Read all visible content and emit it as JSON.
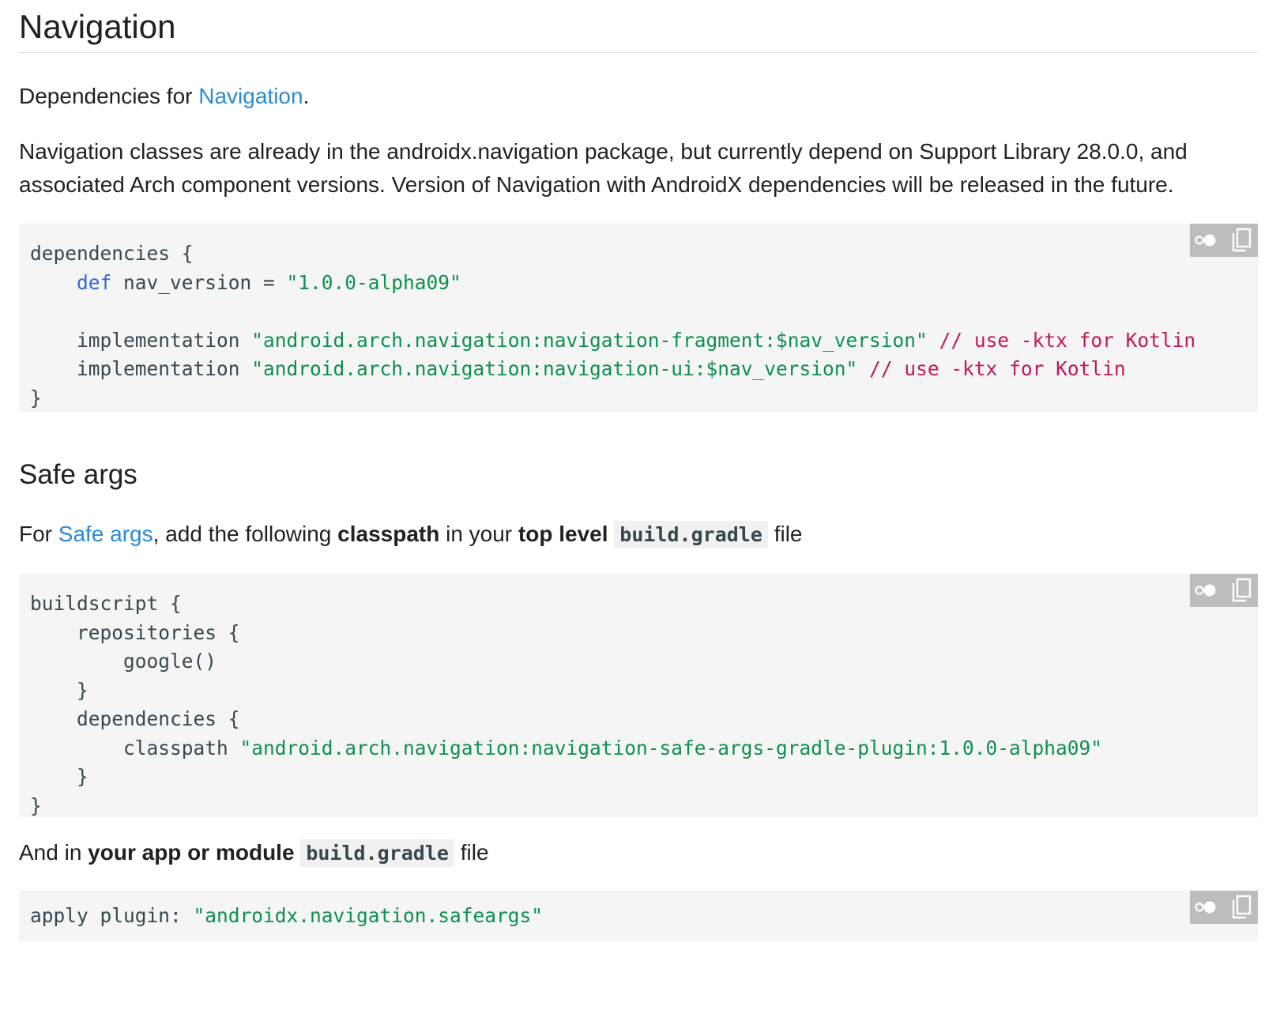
{
  "navigation_section": {
    "title": "Navigation",
    "deps_intro": {
      "prefix": "Dependencies for ",
      "link": "Navigation",
      "suffix": "."
    },
    "description": "Navigation classes are already in the androidx.navigation package, but currently depend on Support Library 28.0.0, and associated Arch component versions. Version of Navigation with AndroidX dependencies will be released in the future.",
    "code": {
      "line1": "dependencies {",
      "line2_kw": "def",
      "line2_rest": " nav_version = ",
      "line2_str": "\"1.0.0-alpha09\"",
      "line4_pre": "implementation ",
      "line4_str": "\"android.arch.navigation:navigation-fragment:$nav_version\"",
      "line4_com": "// use -ktx for Kotlin",
      "line5_pre": "implementation ",
      "line5_str": "\"android.arch.navigation:navigation-ui:$nav_version\"",
      "line5_com": "// use -ktx for Kotlin",
      "line6": "}"
    }
  },
  "safe_args_section": {
    "title": "Safe args",
    "intro": {
      "prefix": "For ",
      "link": "Safe args",
      "mid1": ", add the following ",
      "bold1": "classpath",
      "mid2": " in your ",
      "bold2": "top level",
      "code": "build.gradle",
      "suffix": " file"
    },
    "code": {
      "line1": "buildscript {",
      "line2": "repositories {",
      "line3": "google()",
      "line4": "}",
      "line5": "dependencies {",
      "line6_pre": "classpath ",
      "line6_str": "\"android.arch.navigation:navigation-safe-args-gradle-plugin:1.0.0-alpha09\"",
      "line7": "}",
      "line8": "}"
    },
    "app_intro": {
      "prefix": "And in ",
      "bold": "your app or module",
      "code": "build.gradle",
      "suffix": " file"
    },
    "app_code": {
      "pre": "apply plugin: ",
      "str": "\"androidx.navigation.safeargs\""
    }
  },
  "icons": {
    "theme_toggle": "dark-theme-toggle-icon",
    "copy": "copy-icon"
  },
  "colors": {
    "link": "#2a8ad4",
    "keyword": "#3367d6",
    "string": "#0d904f",
    "comment": "#c2185b",
    "code_bg": "#f5f5f5",
    "action_bg": "#bdbdbd"
  }
}
